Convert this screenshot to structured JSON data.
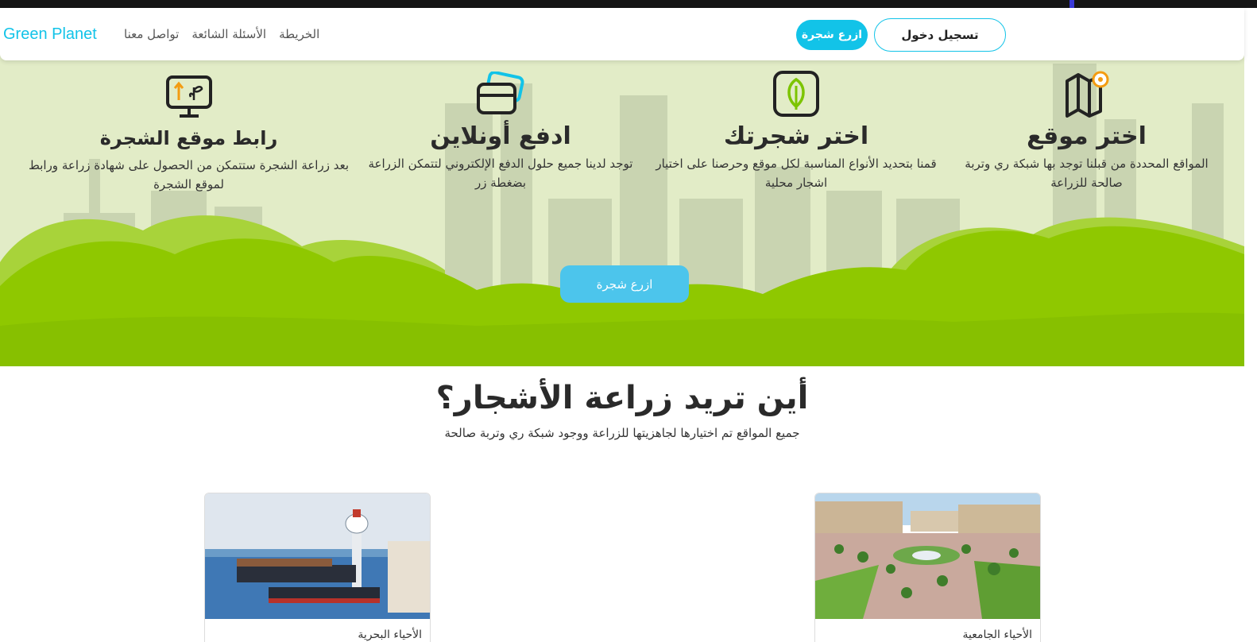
{
  "brand": "Green Planet",
  "nav": {
    "links": [
      "الخريطة",
      "الأسئلة الشائعة",
      "تواصل معنا"
    ],
    "plant_button": "ازرع شجرة",
    "login_button": "تسجيل دخول"
  },
  "steps": [
    {
      "title": "اختر موقع",
      "text": "المواقع المحددة من قبلنا توجد بها شبكة ري وتربة صالحة للزراعة",
      "icon": "map-pin-icon"
    },
    {
      "title": "اختر شجرتك",
      "text": "قمنا بتحديد الأنواع المناسبة لكل موقع وحرصنا على اختيار اشجار محلية",
      "icon": "leaf-icon"
    },
    {
      "title": "ادفع أونلاين",
      "text": "توجد لدينا جميع حلول الدفع الإلكتروني لتتمكن الزراعة بضغطة زر",
      "icon": "credit-card-icon"
    },
    {
      "title": "رابط موقع الشجرة",
      "text": "بعد زراعة الشجرة ستتمكن من الحصول على شهادة زراعة ورابط لموقع الشجرة",
      "icon": "monitor-plant-icon"
    }
  ],
  "hero_button": "ازرع شجرة",
  "locations": {
    "title": "أين تريد زراعة الأشجار؟",
    "subtitle": "جميع المواقع تم اختيارها لجاهزيتها للزراعة ووجود شبكة ري وتربة صالحة",
    "cards": [
      {
        "image": "campus-plaza-photo",
        "caption": "الأحياء الجامعية"
      },
      {
        "image": "port-tower-photo",
        "caption": "الأحياء البحرية"
      }
    ]
  },
  "colors": {
    "accent": "#12c3e8",
    "hero_bg": "#e2ecc7",
    "bush": "#8fc800",
    "bush_light": "#a9d43a",
    "city": "#c8d3b0"
  }
}
